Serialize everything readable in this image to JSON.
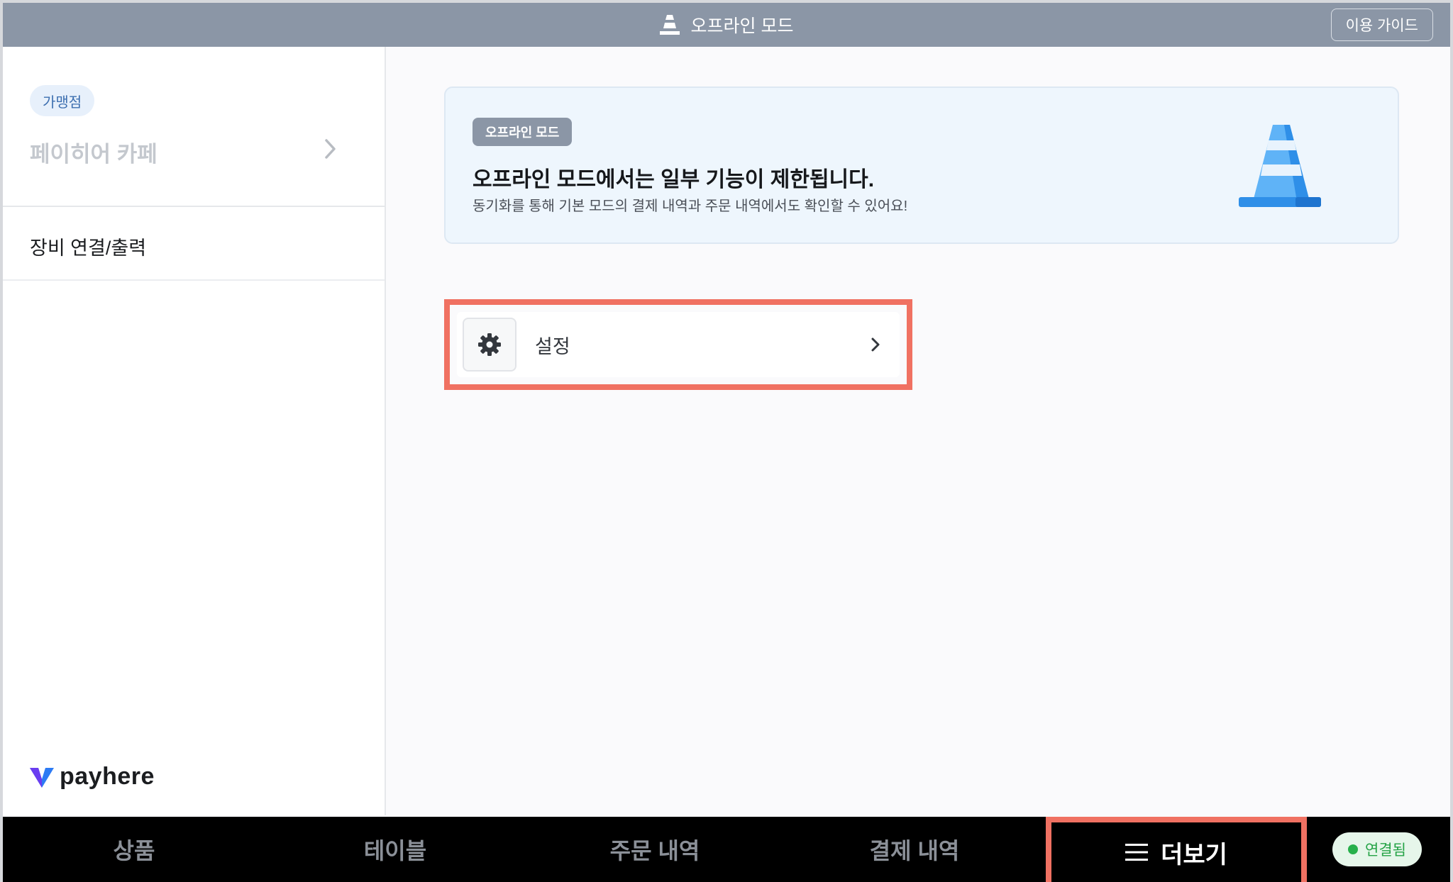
{
  "topbar": {
    "title": "오프라인 모드",
    "guide_label": "이용 가이드",
    "cone_icon": "traffic-cone-icon"
  },
  "sidebar": {
    "store_badge": "가맹점",
    "store_name": "페이히어 카페",
    "item_device": "장비 연결/출력",
    "logo_text": "payhere"
  },
  "banner": {
    "badge": "오프라인 모드",
    "title": "오프라인 모드에서는 일부 기능이 제한됩니다.",
    "description": "동기화를 통해 기본 모드의 결제 내역과 주문 내역에서도 확인할 수 있어요!"
  },
  "settings": {
    "label": "설정",
    "icon": "gear-icon"
  },
  "bottom_nav": {
    "items": [
      "상품",
      "테이블",
      "주문 내역",
      "결제 내역"
    ],
    "more_label": "더보기",
    "status_label": "연결됨"
  },
  "colors": {
    "topbar": "#8b96a6",
    "highlight": "#f07162",
    "cone_blue": "#3a9cf0",
    "status_green": "#27b04b"
  }
}
